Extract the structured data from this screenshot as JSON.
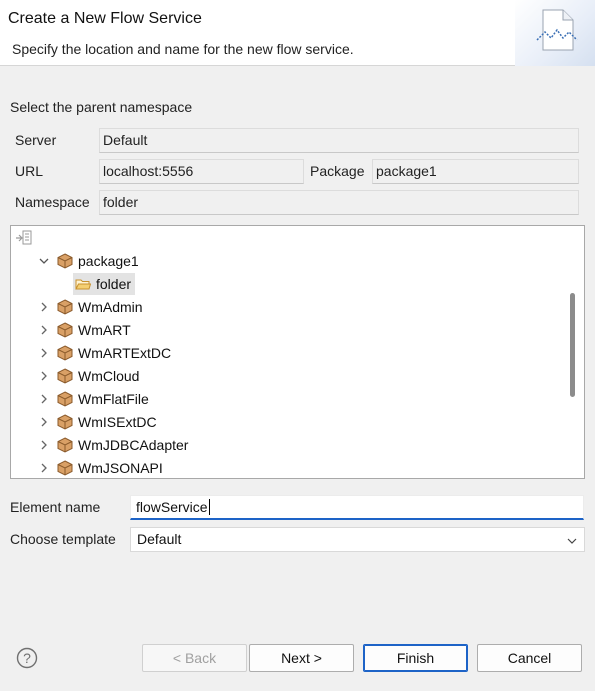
{
  "header": {
    "title": "Create a New Flow Service",
    "description": "Specify the location and name for the new  flow service."
  },
  "namespace_section": {
    "label": "Select the parent namespace",
    "server_label": "Server",
    "server_value": "Default",
    "url_label": "URL",
    "url_value": "localhost:5556",
    "package_label": "Package",
    "package_value": "package1",
    "namespace_label": "Namespace",
    "namespace_value": "folder"
  },
  "tree": {
    "expanded_package": "package1",
    "selected_folder": "folder",
    "packages": [
      "WmAdmin",
      "WmART",
      "WmARTExtDC",
      "WmCloud",
      "WmFlatFile",
      "WmISExtDC",
      "WmJDBCAdapter",
      "WmJSONAPI"
    ]
  },
  "form": {
    "element_name_label": "Element name",
    "element_name_value": "flowService",
    "template_label": "Choose template",
    "template_value": "Default"
  },
  "buttons": {
    "help": "?",
    "back": "< Back",
    "next": "Next >",
    "finish": "Finish",
    "cancel": "Cancel"
  },
  "colors": {
    "accent": "#1d63c7",
    "package_icon": "#c8894f",
    "folder_icon": "#e8b64a"
  }
}
